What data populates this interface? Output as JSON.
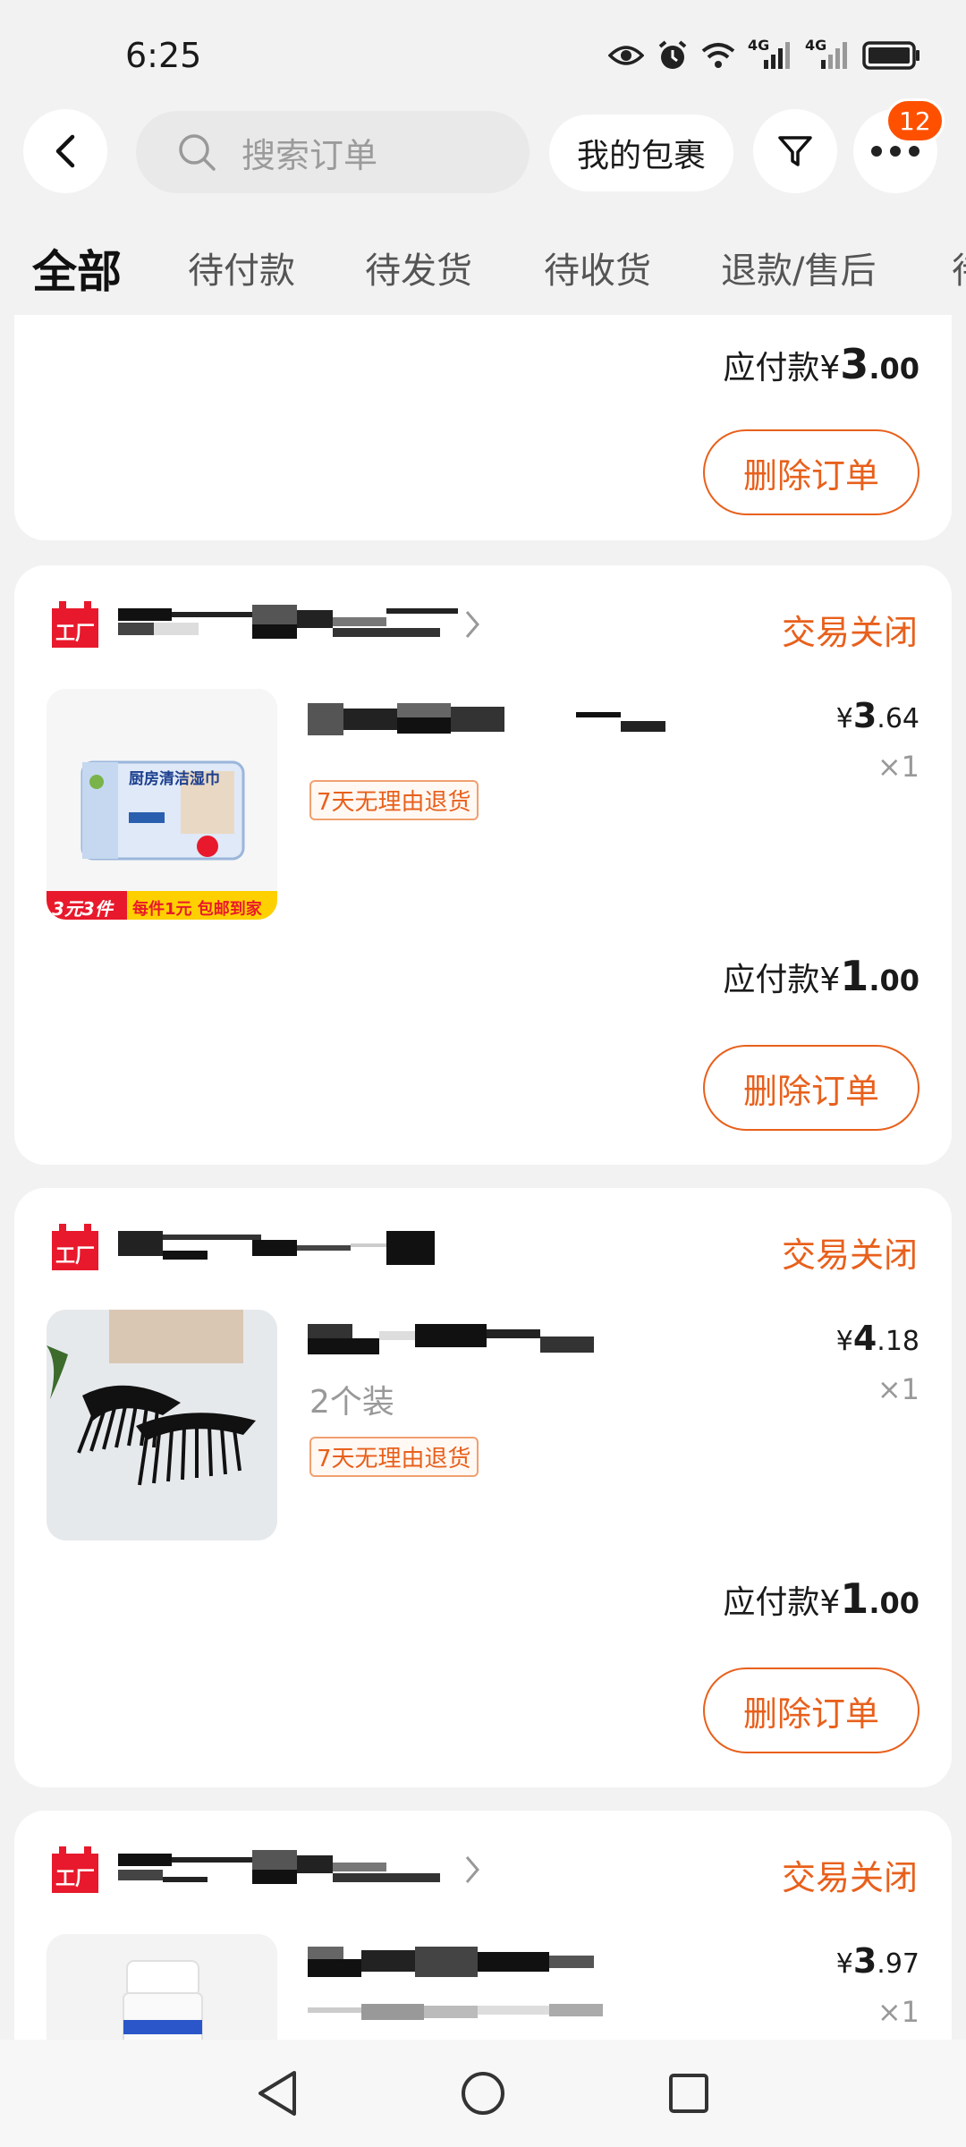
{
  "status_bar": {
    "time": "6:25",
    "icons": [
      "eye-icon",
      "alarm-icon",
      "wifi-icon",
      "signal-4g-icon",
      "signal-4g-icon",
      "battery-icon"
    ],
    "network_label_1": "4G",
    "network_label_2": "4G"
  },
  "header": {
    "search_placeholder": "搜索订单",
    "packages_label": "我的包裹",
    "more_badge": "12"
  },
  "tabs": [
    {
      "label": "全部",
      "active": true
    },
    {
      "label": "待付款",
      "active": false
    },
    {
      "label": "待发货",
      "active": false
    },
    {
      "label": "待收货",
      "active": false
    },
    {
      "label": "退款/售后",
      "active": false
    },
    {
      "label": "待",
      "active": false
    }
  ],
  "orders": [
    {
      "total_label": "应付款",
      "currency": "¥",
      "total_int": "3",
      "total_dec": ".00",
      "delete_label": "删除订单"
    },
    {
      "shop_icon_text": "工厂",
      "status": "交易关闭",
      "price_int": "3",
      "price_dec": ".64",
      "currency": "¥",
      "qty": "×1",
      "return_tag": "7天无理由退货",
      "thumb_banner_left": "3元3件",
      "thumb_banner_right": "每件1元 包邮到家",
      "thumb_pkg_text": "厨房清洁湿巾",
      "total_label": "应付款",
      "total_int": "1",
      "total_dec": ".00",
      "delete_label": "删除订单"
    },
    {
      "shop_icon_text": "工厂",
      "status": "交易关闭",
      "price_int": "4",
      "price_dec": ".18",
      "currency": "¥",
      "qty": "×1",
      "variant": "2个装",
      "return_tag": "7天无理由退货",
      "total_label": "应付款",
      "total_int": "1",
      "total_dec": ".00",
      "delete_label": "删除订单"
    },
    {
      "shop_icon_text": "工厂",
      "status": "交易关闭",
      "price_int": "3",
      "price_dec": ".97",
      "currency": "¥",
      "qty": "×1"
    }
  ],
  "colors": {
    "accent": "#e8601c",
    "badge": "#ff5000",
    "shop_icon": "#e8192c",
    "background": "#f2f2f2"
  }
}
